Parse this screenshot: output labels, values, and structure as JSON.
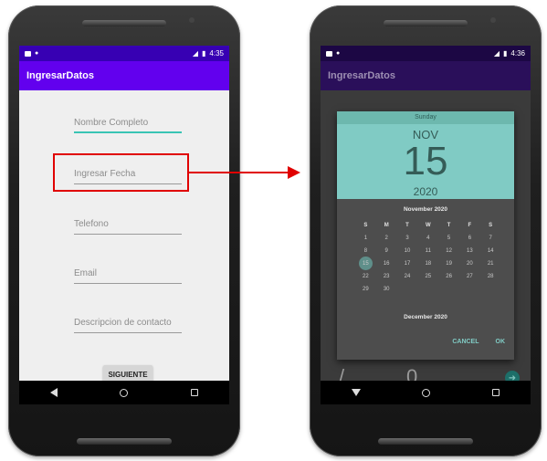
{
  "left_screen": {
    "status_time": "4:35",
    "app_title": "IngresarDatos",
    "fields": [
      {
        "placeholder": "Nombre Completo"
      },
      {
        "placeholder": "Ingresar Fecha"
      },
      {
        "placeholder": "Telefono"
      },
      {
        "placeholder": "Email"
      },
      {
        "placeholder": "Descripcion de contacto"
      }
    ],
    "next_button": "SIGUIENTE"
  },
  "right_screen": {
    "status_time": "4:36",
    "app_title": "IngresarDatos",
    "date_picker": {
      "weekday": "Sunday",
      "month": "NOV",
      "day": "15",
      "year": "2020",
      "calendar_title": "November 2020",
      "next_month_title": "December 2020",
      "weekday_headers": [
        "S",
        "M",
        "T",
        "W",
        "T",
        "F",
        "S"
      ],
      "weeks": [
        [
          "1",
          "2",
          "3",
          "4",
          "5",
          "6",
          "7"
        ],
        [
          "8",
          "9",
          "10",
          "11",
          "12",
          "13",
          "14"
        ],
        [
          "15",
          "16",
          "17",
          "18",
          "19",
          "20",
          "21"
        ],
        [
          "22",
          "23",
          "24",
          "25",
          "26",
          "27",
          "28"
        ],
        [
          "29",
          "30",
          "",
          "",
          "",
          "",
          ""
        ]
      ],
      "selected_day": "15",
      "cancel_label": "CANCEL",
      "ok_label": "OK"
    },
    "keyboard_keys": [
      "/",
      "0",
      "_"
    ]
  },
  "colors": {
    "status_bar": "#3700b3",
    "app_bar": "#6200ee",
    "accent": "#80cbc4",
    "highlight": "#e00000"
  }
}
